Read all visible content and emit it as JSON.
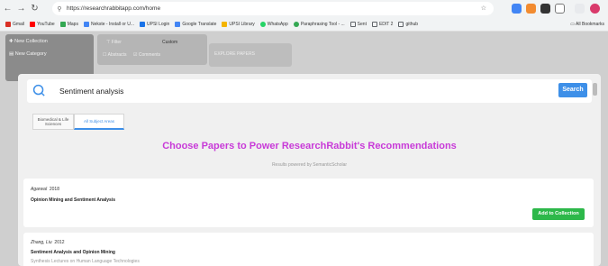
{
  "browser": {
    "url": "https://researchrabbitapp.com/home",
    "bookmarks": [
      {
        "label": "Gmail",
        "color": "#d93025"
      },
      {
        "label": "YouTube",
        "color": "#ff0000"
      },
      {
        "label": "Maps",
        "color": "#34a853"
      },
      {
        "label": "Nekste - Install or U...",
        "color": "#4285f4"
      },
      {
        "label": "UPSI Login",
        "color": "#1a73e8"
      },
      {
        "label": "Google Translate",
        "color": "#4285f4"
      },
      {
        "label": "UPSI Library",
        "color": "#f4b400"
      },
      {
        "label": "WhatsApp",
        "color": "#25d366"
      },
      {
        "label": "Paraphrasing Tool - ...",
        "color": "#34a853"
      },
      {
        "label": "Sent",
        "color": "#5f6368"
      },
      {
        "label": "EDIT 2",
        "color": "#5f6368"
      },
      {
        "label": "github",
        "color": "#5f6368"
      }
    ],
    "all_bookmarks": "All Bookmarks"
  },
  "background": {
    "sidebar_items": [
      "New Collection",
      "New Category"
    ],
    "filter_label": "Filter",
    "filter_value": "Custom",
    "checkbox_abstracts": "Abstracts",
    "checkbox_comments": "Comments",
    "explore_label": "EXPLORE PAPERS"
  },
  "modal": {
    "search_value": "Sentiment analysis",
    "search_button": "Search",
    "tabs": [
      {
        "label": "Biomedical & Life Sciences",
        "active": false
      },
      {
        "label": "All Subject Areas",
        "active": true
      }
    ],
    "heading": "Choose Papers to Power ResearchRabbit's Recommendations",
    "powered_by": "Results powered by SemanticScholar",
    "add_button": "Add to Collection",
    "results": [
      {
        "author": "Agarwal",
        "year": "2018",
        "title": "Opinion Mining and Sentiment Analysis",
        "venue": ""
      },
      {
        "author": "Zhang, Liu",
        "year": "2012",
        "title": "Sentiment Analysis and Opinion Mining",
        "venue": "Synthesis Lectures on Human Language Technologies"
      }
    ]
  },
  "colors": {
    "accent": "#3d8fe8",
    "heading": "#c83ad8",
    "add": "#2db84a"
  }
}
